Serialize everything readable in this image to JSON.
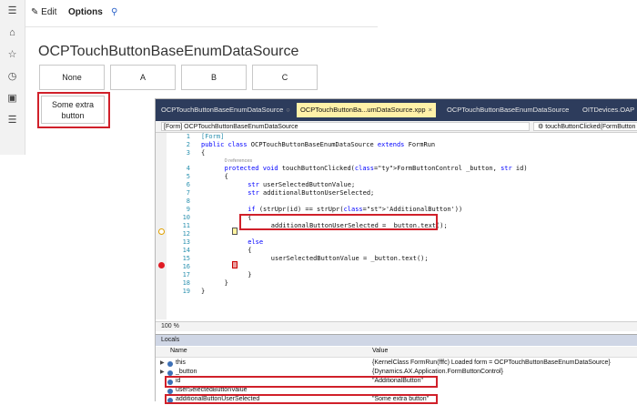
{
  "d365": {
    "toolbar": {
      "edit": "Edit",
      "options": "Options"
    },
    "form_title": "OCPTouchButtonBaseEnumDataSource",
    "buttons": [
      "None",
      "A",
      "B",
      "C"
    ],
    "extra_button": "Some extra button"
  },
  "vs": {
    "tabs": [
      {
        "label": "OCPTouchButtonBaseEnumDataSource"
      },
      {
        "label": "OCPTouchButtonBa...umDataSource.xpp"
      },
      {
        "label": "OCPTouchButtonBaseEnumDataSource"
      },
      {
        "label": "OITDevices.OAP"
      }
    ],
    "nav_left": "[Form] OCPTouchButtonBaseEnumDataSource",
    "nav_right": "touchButtonClicked(FormButton",
    "code_lines": [
      {
        "num": "1",
        "text": "[Form]"
      },
      {
        "num": "2",
        "text": "public class OCPTouchButtonBaseEnumDataSource extends FormRun"
      },
      {
        "num": "3",
        "text": "{"
      },
      {
        "num": "",
        "text": "0 references"
      },
      {
        "num": "4",
        "text": "protected void touchButtonClicked(FormButtonControl _button, str id)"
      },
      {
        "num": "5",
        "text": "{"
      },
      {
        "num": "6",
        "text": "str userSelectedButtonValue;"
      },
      {
        "num": "7",
        "text": "str additionalButtonUserSelected;"
      },
      {
        "num": "8",
        "text": ""
      },
      {
        "num": "9",
        "text": "if (strUpr(id) == strUpr('AdditionalButton'))"
      },
      {
        "num": "10",
        "text": "{"
      },
      {
        "num": "11",
        "text": "additionalButtonUserSelected = _button.text();"
      },
      {
        "num": "12",
        "text": ""
      },
      {
        "num": "13",
        "text": "else"
      },
      {
        "num": "14",
        "text": "{"
      },
      {
        "num": "15",
        "text": "userSelectedButtonValue = _button.text();"
      },
      {
        "num": "16",
        "text": ""
      },
      {
        "num": "17",
        "text": "}"
      },
      {
        "num": "18",
        "text": "}"
      },
      {
        "num": "19",
        "text": "}"
      }
    ],
    "zoom": "100 %",
    "locals": {
      "title": "Locals",
      "col_name": "Name",
      "col_value": "Value",
      "rows": [
        {
          "name": "this",
          "value": "{KernelClass FormRun(fffc) Loaded form = OCPTouchButtonBaseEnumDataSource}"
        },
        {
          "name": "_button",
          "value": "{Dynamics.AX.Application.FormButtonControl}"
        },
        {
          "name": "id",
          "value": "\"AdditionalButton\""
        },
        {
          "name": "userSelectedButtonValue",
          "value": ""
        },
        {
          "name": "additionalButtonUserSelected",
          "value": "\"Some extra button\""
        }
      ]
    }
  },
  "colors": {
    "highlight": "#d0202a",
    "tab_bar": "#2d3c5c",
    "active_tab": "#fff1a8",
    "keyword": "#0000ff",
    "type": "#2b91af"
  }
}
